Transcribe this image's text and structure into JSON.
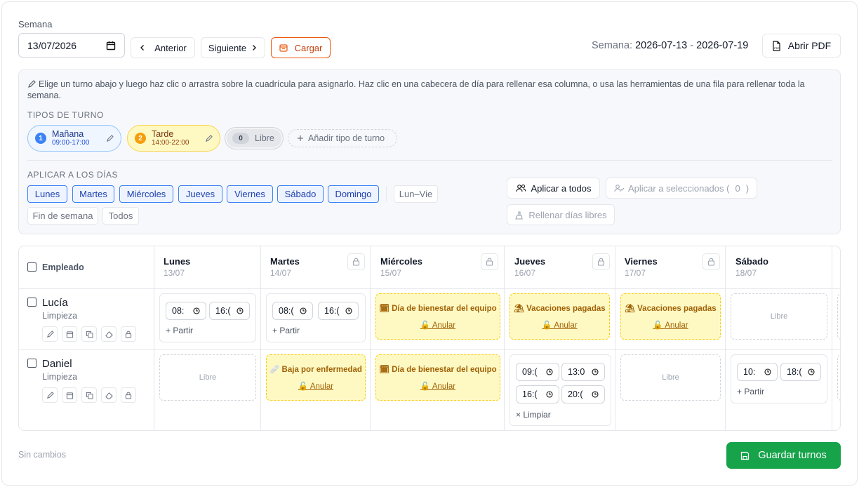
{
  "week": {
    "label": "Semana",
    "date_value": "13/07/2026",
    "prev": "Anterior",
    "next": "Siguiente",
    "load": "Cargar",
    "range_label": "Semana:",
    "range_start": "2026-07-13",
    "range_sep": "-",
    "range_end": "2026-07-19",
    "pdf": "Abrir PDF"
  },
  "panel": {
    "hint": "Elige un turno abajo y luego haz clic o arrastra sobre la cuadrícula para asignarlo. Haz clic en una cabecera de día para rellenar esa columna, o usa las herramientas de una fila para rellenar toda la semana.",
    "types_title": "TIPOS DE TURNO",
    "types": [
      {
        "num": "1",
        "name": "Mañana",
        "time": "09:00-17:00",
        "color": "#3b82f6"
      },
      {
        "num": "2",
        "name": "Tarde",
        "time": "14:00-22:00",
        "color": "#f59e0b"
      }
    ],
    "libre_count": "0",
    "libre_label": "Libre",
    "add_type": "Añadir tipo de turno",
    "days_title": "APLICAR A LOS DÍAS",
    "days": [
      "Lunes",
      "Martes",
      "Miércoles",
      "Jueves",
      "Viernes",
      "Sábado",
      "Domingo"
    ],
    "presets": [
      "Lun–Vie",
      "Fin de semana",
      "Todos"
    ],
    "apply_all": "Aplicar a todos",
    "apply_selected": "Aplicar a seleccionados (",
    "selected_count": "0",
    "apply_selected_end": ")",
    "fill_free": "Rellenar días libres"
  },
  "grid": {
    "employee_header": "Empleado",
    "days": [
      {
        "name": "Lunes",
        "date": "13/07"
      },
      {
        "name": "Martes",
        "date": "14/07"
      },
      {
        "name": "Miércoles",
        "date": "15/07"
      },
      {
        "name": "Jueves",
        "date": "16/07"
      },
      {
        "name": "Viernes",
        "date": "17/07"
      },
      {
        "name": "Sábado",
        "date": "18/07"
      }
    ],
    "employees": [
      {
        "name": "Lucía",
        "role": "Limpieza"
      },
      {
        "name": "Daniel",
        "role": "Limpieza"
      }
    ],
    "free_label": "Libre",
    "split_label": "Partir",
    "clear_label": "Limpiar",
    "undo_label": "Anular",
    "lucia": {
      "mon": [
        "08:",
        "16:("
      ],
      "tue": [
        "08:(",
        "16:("
      ],
      "wed": "Día de bienestar del equipo",
      "thu": "Vacaciones pagadas",
      "fri": "Vacaciones pagadas"
    },
    "daniel": {
      "tue": "Baja por enfermedad",
      "wed": "Día de bienestar del equipo",
      "thu": [
        "09:(",
        "13:0",
        "16:(",
        "20:("
      ],
      "sat": [
        "10:",
        "18:("
      ]
    }
  },
  "footer": {
    "status": "Sin cambios",
    "save": "Guardar turnos"
  }
}
